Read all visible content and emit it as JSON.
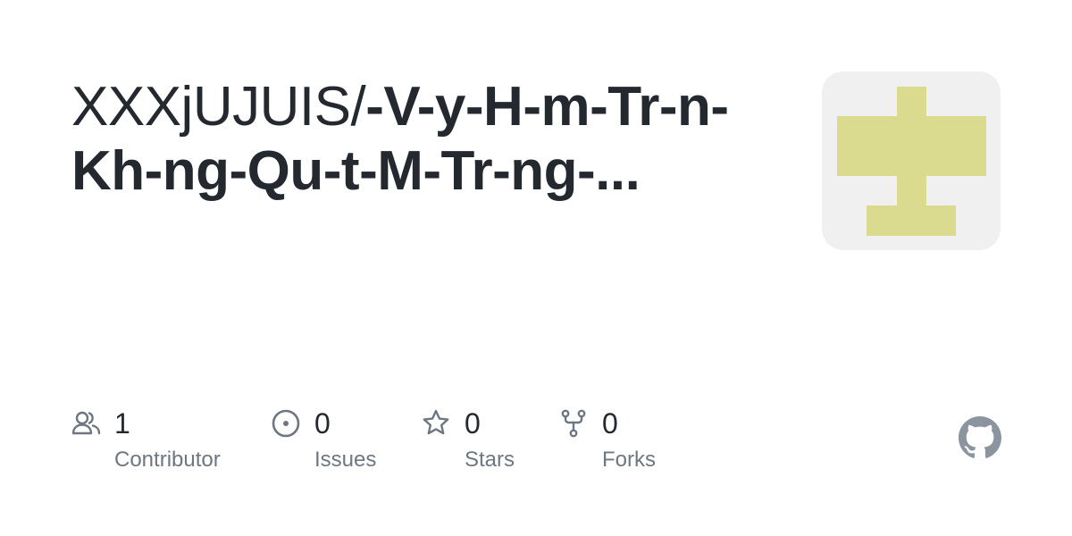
{
  "repo": {
    "owner_prefix": "XXXjUJUIS/",
    "name": "-V-y-H-m-Tr-n-Kh-ng-Qu-t-M-Tr-ng-..."
  },
  "stats": {
    "contributors": {
      "count": "1",
      "label": "Contributor"
    },
    "issues": {
      "count": "0",
      "label": "Issues"
    },
    "stars": {
      "count": "0",
      "label": "Stars"
    },
    "forks": {
      "count": "0",
      "label": "Forks"
    }
  },
  "icons": {
    "contributors": "people-icon",
    "issues": "issue-opened-icon",
    "stars": "star-icon",
    "forks": "repo-forked-icon",
    "brand": "github-logo-icon"
  },
  "colors": {
    "title_text": "#24292f",
    "muted_text": "#6e7781",
    "icon": "#6e7781",
    "avatar_background": "#f0f0f0",
    "avatar_pattern": "#dbdb8f"
  }
}
